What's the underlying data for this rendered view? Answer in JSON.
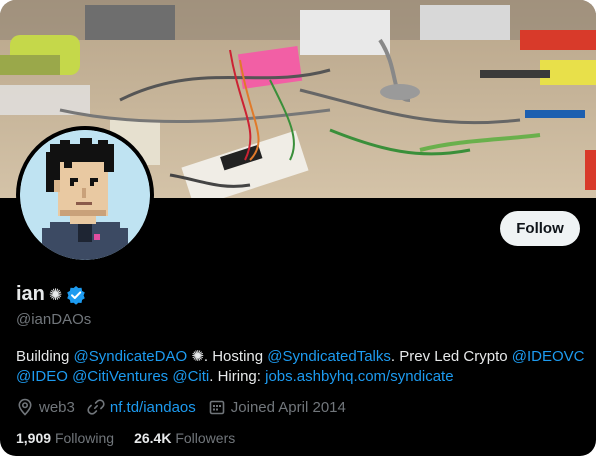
{
  "profile": {
    "name": "ian",
    "name_emoji": "✺",
    "handle": "@ianDAOs",
    "verified": true,
    "follow_label": "Follow",
    "bio": {
      "t1": "Building ",
      "m1": "@SyndicateDAO",
      "t2": " ✺. Hosting ",
      "m2": "@SyndicatedTalks",
      "t3": ". Prev Led Crypto ",
      "m3": "@IDEOVC",
      "m4": "@IDEO",
      "m5": "@CitiVentures",
      "m6": "@Citi",
      "t4": ". Hiring: ",
      "m7": "jobs.ashbyhq.com/syndicate"
    },
    "location": "web3",
    "website": "nf.td/iandaos",
    "joined": "Joined April 2014",
    "following_count": "1,909",
    "following_label": "Following",
    "followers_count": "26.4K",
    "followers_label": "Followers"
  },
  "icons": {
    "verified": "verified-badge-icon",
    "location": "location-pin-icon",
    "link": "link-icon",
    "calendar": "calendar-icon"
  },
  "colors": {
    "background": "#000000",
    "text": "#e7e9ea",
    "muted": "#71767b",
    "link": "#1d9bf0",
    "button_bg": "#eff3f4"
  }
}
